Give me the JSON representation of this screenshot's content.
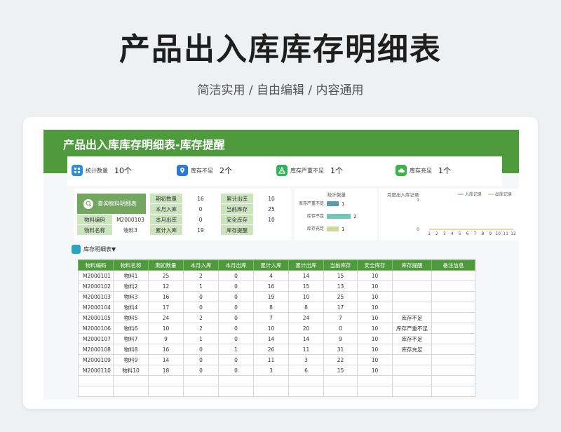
{
  "hero": {
    "title": "产品出入库库存明细表",
    "subtitle": "简洁实用 / 自由编辑 / 内容通用"
  },
  "sheet": {
    "title": "产品出入库库存明细表-库存提醒"
  },
  "stats": [
    {
      "label": "统计数量",
      "value": "10个",
      "color": "#2b8fe0",
      "icon": "grid-icon"
    },
    {
      "label": "库存不足",
      "value": "2个",
      "color": "#2979d9",
      "icon": "pin-icon"
    },
    {
      "label": "库存严重不足",
      "value": "1个",
      "color": "#2fb457",
      "icon": "warning-icon"
    },
    {
      "label": "库存充足",
      "value": "1个",
      "color": "#3cb24b",
      "icon": "cloud-icon"
    }
  ],
  "query": {
    "button_label": "查询物料明细表",
    "code_label": "物料编码",
    "code_value": "M2000103",
    "name_label": "物料名称",
    "name_value": "物料3",
    "opening_label": "期初数量",
    "opening_value": "16",
    "in_month_label": "本月入库",
    "in_month_value": "0",
    "out_month_label": "本月出库",
    "out_month_value": "0",
    "total_in_label": "累计入库",
    "total_in_value": "19",
    "total_out_label": "累计出库",
    "total_out_value": "10",
    "current_label": "当前库存",
    "current_value": "25",
    "safety_label": "安全库存",
    "safety_value": "10",
    "alert_label": "库存提醒",
    "alert_value": ""
  },
  "chart_data": [
    {
      "type": "bar",
      "title": "统计数量",
      "orientation": "horizontal",
      "categories": [
        "库存严重不足",
        "库存不足",
        "库存充足"
      ],
      "values": [
        1,
        2,
        1
      ],
      "colors": [
        "#5b9bab",
        "#71c7b8",
        "#cbd99a"
      ]
    },
    {
      "type": "line",
      "title": "月度出入库记录",
      "x": [
        1,
        2,
        3,
        4,
        5,
        6,
        7,
        8,
        9,
        10,
        11,
        12
      ],
      "ylim": [
        0,
        1
      ],
      "yticks": [
        "0",
        "1"
      ],
      "series": [
        {
          "name": "入库记录",
          "color": "#5b9bd5",
          "values": [
            0,
            0,
            0,
            0,
            0,
            0,
            0,
            0,
            0,
            0,
            0,
            0
          ]
        },
        {
          "name": "出库记录",
          "color": "#c9b458",
          "values": [
            0,
            0,
            0,
            0,
            0,
            0,
            0,
            0,
            0,
            0,
            0,
            0
          ]
        }
      ],
      "legend": "top-right"
    }
  ],
  "detail": {
    "label": "库存明细表▼",
    "columns": [
      "物料编码",
      "物料名称",
      "期初数量",
      "本月入库",
      "本月出库",
      "累计入库",
      "累计出库",
      "当前库存",
      "安全库存",
      "库存提醒",
      "备注信息"
    ],
    "rows": [
      [
        "M2000101",
        "物料1",
        "25",
        "2",
        "0",
        "4",
        "14",
        "15",
        "10",
        "",
        ""
      ],
      [
        "M2000102",
        "物料2",
        "12",
        "1",
        "0",
        "16",
        "15",
        "13",
        "10",
        "",
        ""
      ],
      [
        "M2000103",
        "物料3",
        "16",
        "0",
        "0",
        "19",
        "10",
        "25",
        "10",
        "",
        ""
      ],
      [
        "M2000104",
        "物料4",
        "17",
        "0",
        "0",
        "8",
        "8",
        "17",
        "10",
        "",
        ""
      ],
      [
        "M2000105",
        "物料5",
        "24",
        "2",
        "0",
        "7",
        "24",
        "7",
        "10",
        "库存不足",
        ""
      ],
      [
        "M2000106",
        "物料6",
        "10",
        "2",
        "0",
        "10",
        "20",
        "0",
        "10",
        "库存严重不足",
        ""
      ],
      [
        "M2000107",
        "物料7",
        "9",
        "1",
        "0",
        "14",
        "14",
        "9",
        "10",
        "库存不足",
        ""
      ],
      [
        "M2000108",
        "物料8",
        "16",
        "0",
        "1",
        "26",
        "11",
        "31",
        "10",
        "库存充足",
        ""
      ],
      [
        "M2000109",
        "物料9",
        "14",
        "0",
        "0",
        "11",
        "3",
        "22",
        "10",
        "",
        ""
      ],
      [
        "M2000110",
        "物料10",
        "18",
        "0",
        "0",
        "3",
        "6",
        "15",
        "10",
        "",
        ""
      ]
    ]
  }
}
